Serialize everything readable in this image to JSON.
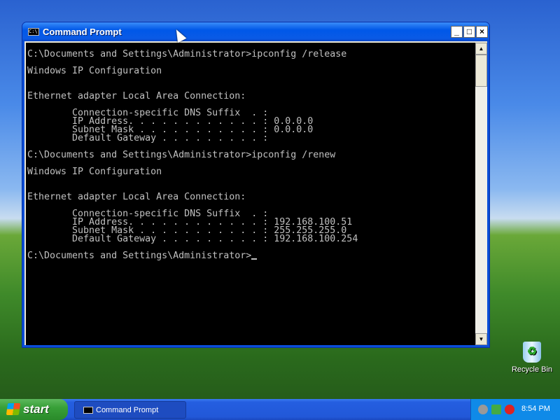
{
  "window": {
    "title": "Command Prompt",
    "minimize": "_",
    "maximize": "□",
    "close": "×",
    "icon_text": "C:\\"
  },
  "console": {
    "lines": [
      "C:\\Documents and Settings\\Administrator>ipconfig /release",
      "",
      "Windows IP Configuration",
      "",
      "",
      "Ethernet adapter Local Area Connection:",
      "",
      "        Connection-specific DNS Suffix  . :",
      "        IP Address. . . . . . . . . . . . : 0.0.0.0",
      "        Subnet Mask . . . . . . . . . . . : 0.0.0.0",
      "        Default Gateway . . . . . . . . . :",
      "",
      "C:\\Documents and Settings\\Administrator>ipconfig /renew",
      "",
      "Windows IP Configuration",
      "",
      "",
      "Ethernet adapter Local Area Connection:",
      "",
      "        Connection-specific DNS Suffix  . :",
      "        IP Address. . . . . . . . . . . . : 192.168.100.51",
      "        Subnet Mask . . . . . . . . . . . : 255.255.255.0",
      "        Default Gateway . . . . . . . . . : 192.168.100.254",
      "",
      "C:\\Documents and Settings\\Administrator>"
    ]
  },
  "desktop": {
    "recycle_bin": "Recycle Bin"
  },
  "taskbar": {
    "start": "start",
    "task": "Command Prompt",
    "clock": "8:54 PM",
    "tray_icons": [
      "volume-icon",
      "network-icon",
      "security-alert-icon"
    ]
  }
}
